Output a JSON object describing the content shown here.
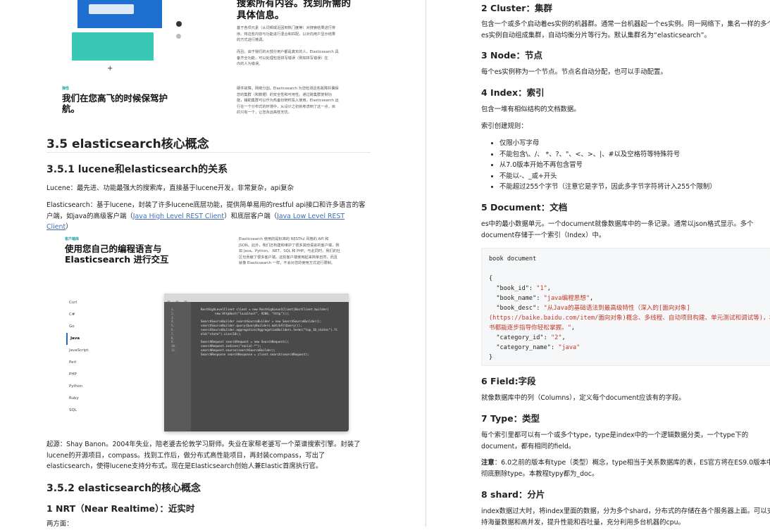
{
  "left": {
    "banner_top": {
      "headline": [
        "搜索所有内容。找到所需的",
        "具体信息。"
      ],
      "para1": [
        "基于各项元素（从词频或近因到热门度等）对搜索结果进行排",
        "序。将这些内容与功能进行混合和匹配，以对向用户显示结果",
        "的方式进行微调。"
      ],
      "para2": [
        "而且，由于我们的大部分用户都是真实的人，Elasticsearch 具",
        "备齐全功能，可以处理包括拼写错误（例如拼写错误）在",
        "内的人为错误。"
      ],
      "tag": "弹性",
      "subhead": [
        "我们在您高飞的时候保驾护",
        "航。"
      ],
      "para3": [
        "硬件故障。网络分割。Elasticsearch 为您检测这些故障并确保",
        "您的集群（和数据）的安全性和可用性。通过跨集群复制功",
        "能，辅助集群可以作为热备份随时投入使用。Elasticsearch 运",
        "行在一个分布式的环境中，从设计之初就考虑到了这一点，目",
        "的只有一个，让您永远高枕无忧。"
      ]
    },
    "section_title": "3.5 elasticsearch核心概念",
    "sub1_title": "3.5.1 lucene和elasticsearch的关系",
    "lucene_para": "Lucene：最先进、功能最强大的搜索库，直接基于lucene开发，非常复杂，api复杂",
    "es_para_prefix": "Elasticsearch：基于lucene，封装了许多lucene底层功能，提供简单易用的restful api接口和许多语言的客户端，如java的高级客户端（",
    "link_high": "Java High Level REST Client",
    "es_para_mid": "）和底层客户端（",
    "link_low": "Java Low Level REST Client",
    "es_para_suffix": "）",
    "client_image": {
      "tag": "客户端库",
      "headline": [
        "使用您自己的编程语言与",
        "Elasticsearch 进行交互"
      ],
      "desc": [
        "Elasticsearch 使用的是标准的 RESTful 风格的 API 和",
        "JSON。此外，我们还构建和维护了很多其他语言的客户端，例",
        "如 Java、Python、.NET、SQL 和 PHP。与此同时，我们的社",
        "区也贡献了很多客户端。这些客户端使用起来简单自然，而且",
        "就像 Elasticsearch 一样，不会对您的使用方式进行限制。"
      ],
      "languages": [
        "Curl",
        "C#",
        "Go",
        "Java",
        "JavaScript",
        "Perl",
        "PHP",
        "Python",
        "Ruby",
        "SQL"
      ],
      "active_language": "Java",
      "line_numbers": "1.\n2.\n3.\n4.\n5.\n6.\n7.\n8.\n9.\n10.\n11.",
      "code": "RestHighLevelClient client = new RestHighLevelClient(RestClient.builder(\n        new HttpHost(\"localhost\", 9200, \"http\")));\n\nSearchSourceBuilder searchSourceBuilder = new SearchSourceBuilder();\nsearchSourceBuilder.query(QueryBuilders.matchAllQuery());\nsearchSourceBuilder.aggregation(AggregationBuilders.terms(\"top_10_states\").fi\neld(\"state\").size(10));\n\nSearchRequest searchRequest = new SearchRequest();\nsearchRequest.indices(\"social-*\");\nsearchRequest.source(searchSourceBuilder);\nSearchResponse searchResponse = client.search(searchRequest);"
    },
    "origin_para": "起源：Shay Banon。2004年失业，陪老婆去伦敦学习厨师。失业在家帮老婆写一个菜谱搜索引擎。封装了lucene的开源项目，compass。找到工作后，做分布式高性能项目，再封装compass，写出了elasticsearch，使得lucene支持分布式。现在是Elasticsearch创始人兼Elastic首席执行官。",
    "sub2_title": "3.5.2 elasticsearch的核心概念",
    "nrt_title": "1 NRT（Near Realtime）：近实时",
    "cut_text": "两方面："
  },
  "right": {
    "cluster_title": "2 Cluster：集群",
    "cluster_para": "包含一个或多个启动着es实例的机器群。通常一台机器起一个es实例。同一网络下，集名一样的多个es实例自动组成集群，自动均衡分片等行为。默认集群名为“elasticsearch”。",
    "node_title": "3 Node：节点",
    "node_para": "每个es实例称为一个节点。节点名自动分配，也可以手动配置。",
    "index_title": "4 Index：索引",
    "index_para": "包含一堆有相似结构的文档数据。",
    "index_rules_label": "索引创建规则：",
    "index_rules": [
      "仅限小写字母",
      "不能包含\\、/、 *、?、\"、<、>、|、#以及空格符等特殊符号",
      "从7.0版本开始不再包含冒号",
      "不能以-、_或+开头",
      "不能超过255个字节（注意它是字节，因此多字节字符将计入255个限制）"
    ],
    "document_title": "5 Document：文档",
    "document_para": "es中的最小数据单元。一个document就像数据库中的一条记录。通常以json格式显示。多个document存储于一个索引（Index）中。",
    "code_header": "book document",
    "code_lines": [
      [
        "{",
        ""
      ],
      [
        "  \"book_id\": ",
        "\"1\"",
        ","
      ],
      [
        "  \"book_name\": ",
        "\"java编程思想\"",
        ","
      ],
      [
        "  \"book_desc\": ",
        "\"从Java的基础语法到最高级特性（深入的[面向对象]",
        ""
      ],
      [
        "",
        "(https://baike.baidu.com/item/面向对象)概念、多线程、自动项目构建、单元测试和调试等)，本",
        ""
      ],
      [
        "",
        "书都能逐步指导你轻松掌握。\"",
        ","
      ],
      [
        "  \"category_id\": ",
        "\"2\"",
        ","
      ],
      [
        "  \"category_name\": ",
        "\"java\"",
        ""
      ],
      [
        "}",
        ""
      ]
    ],
    "field_title": "6 Field:字段",
    "field_para": "就像数据库中的列（Columns），定义每个document应该有的字段。",
    "type_title": "7 Type：类型",
    "type_para": "每个索引里都可以有一个或多个type，type是index中的一个逻辑数据分类，一个type下的document，都有相同的field。",
    "note_label": "注意",
    "note_para": "：6.0之前的版本有type（类型）概念，type相当于关系数据库的表，ES官方将在ES9.0版本中彻底删除type。本教程typy都为_doc。",
    "shard_title": "8 shard：分片",
    "shard_para": "index数据过大时，将index里面的数据，分为多个shard，分布式的存储在各个服务器上面。可以支持海量数据和高并发，提升性能和吞吐量，充分利用多台机器的cpu。"
  }
}
